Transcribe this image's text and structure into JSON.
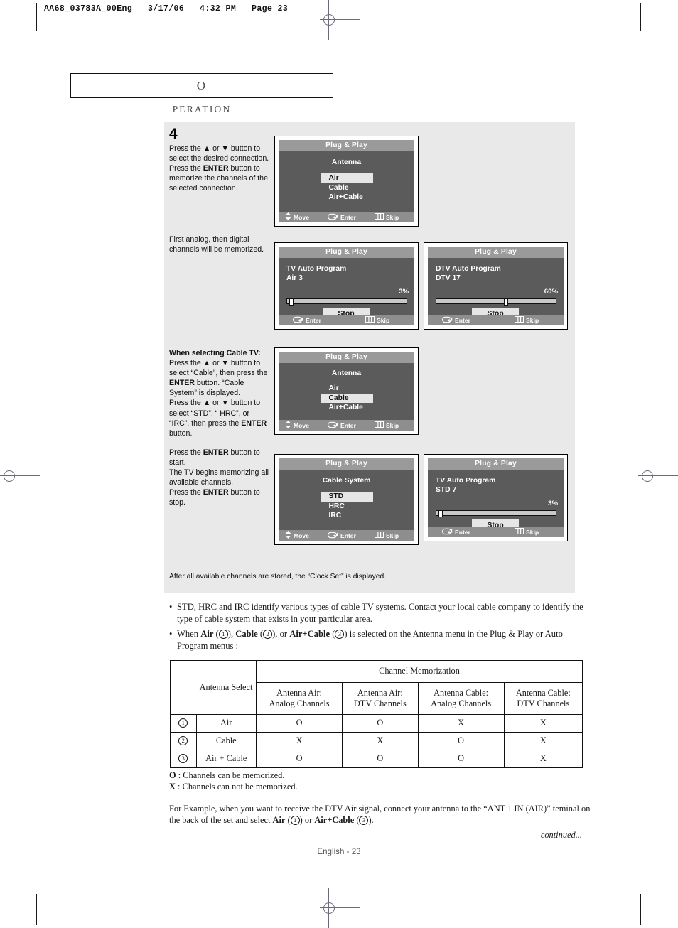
{
  "slug": "AA68_03783A_00Eng   3/17/06   4:32 PM   Page 23",
  "header": {
    "title_first": "O",
    "title_rest": "PERATION"
  },
  "steps": {
    "step_number": "4",
    "step4_text_1": "Press the ▲ or ▼ button to select the desired connection.",
    "step4_text_2_pre": "Press the ",
    "step4_text_2_bold": "ENTER",
    "step4_text_2_post": " button to memorize the channels of the selected connection.",
    "note_analog": "First analog, then digital channels will be memorized.",
    "cable_heading": "When selecting Cable TV:",
    "cable_p1a": "Press the ▲ or ▼ button to select “Cable”, then press the ",
    "cable_p1b": "ENTER",
    "cable_p1c": " button. “Cable System” is displayed.",
    "cable_p2a": "Press the ▲ or ▼ button to select “STD”, “ HRC”, or “IRC”, then press the ",
    "cable_p2b": "ENTER",
    "cable_p2c": " button.",
    "cable_p3a": "Press the ",
    "cable_p3b": "ENTER",
    "cable_p3c": " button to start.",
    "cable_p4": "The TV begins memorizing all available channels.",
    "cable_p5a": "Press the ",
    "cable_p5b": "ENTER",
    "cable_p5c": " button to stop."
  },
  "screens": {
    "antenna_air": {
      "title": "Plug & Play",
      "heading": "Antenna",
      "options": [
        "Air",
        "Cable",
        "Air+Cable"
      ],
      "selected_index": 0,
      "footer": [
        "Move",
        "Enter",
        "Skip"
      ]
    },
    "tv_auto_air": {
      "title": "Plug & Play",
      "line1": "TV Auto Program",
      "line2": "Air 3",
      "percent": "3%",
      "progress": 3,
      "button": "Stop",
      "footer": [
        "Enter",
        "Skip"
      ]
    },
    "dtv_auto": {
      "title": "Plug & Play",
      "line1": "DTV Auto Program",
      "line2": "DTV 17",
      "percent": "60%",
      "progress": 60,
      "button": "Stop",
      "footer": [
        "Enter",
        "Skip"
      ]
    },
    "antenna_cable": {
      "title": "Plug & Play",
      "heading": "Antenna",
      "options": [
        "Air",
        "Cable",
        "Air+Cable"
      ],
      "selected_index": 1,
      "footer": [
        "Move",
        "Enter",
        "Skip"
      ]
    },
    "cable_system": {
      "title": "Plug & Play",
      "heading": "Cable System",
      "options": [
        "STD",
        "HRC",
        "IRC"
      ],
      "selected_index": 0,
      "footer": [
        "Move",
        "Enter",
        "Skip"
      ]
    },
    "tv_auto_std": {
      "title": "Plug & Play",
      "line1": "TV Auto Program",
      "line2": "STD 7",
      "percent": "3%",
      "progress": 3,
      "button": "Stop",
      "footer": [
        "Enter",
        "Skip"
      ]
    }
  },
  "grey_note": "After all available channels are stored, the “Clock Set” is displayed.",
  "bullets": {
    "b1": "STD, HRC and IRC  identify various types of cable TV systems. Contact your local cable company to identify the type of cable system that exists in your particular area.",
    "b2_1": "When ",
    "b2_air": "Air",
    "b2_2": " (",
    "b2_n1": "1",
    "b2_3": "), ",
    "b2_cable": "Cable",
    "b2_4": " (",
    "b2_n2": "2",
    "b2_5": "), or ",
    "b2_aircable": "Air+Cable",
    "b2_6": " (",
    "b2_n3": "3",
    "b2_7": ") is selected on the Antenna menu in the Plug & Play or Auto Program menus :"
  },
  "table": {
    "col_antenna_select": "Antenna Select",
    "col_channel_memorization": "Channel Memorization",
    "subheads": [
      "Antenna Air:\nAnalog Channels",
      "Antenna Air:\nDTV Channels",
      "Antenna Cable:\nAnalog Channels",
      "Antenna Cable:\nDTV Channels"
    ],
    "rows": [
      {
        "num": "1",
        "label": "Air",
        "values": [
          "O",
          "O",
          "X",
          "X"
        ]
      },
      {
        "num": "2",
        "label": "Cable",
        "values": [
          "X",
          "X",
          "O",
          "X"
        ]
      },
      {
        "num": "3",
        "label": "Air + Cable",
        "values": [
          "O",
          "O",
          "O",
          "X"
        ]
      }
    ]
  },
  "legend": {
    "o_key": "O",
    "o_text": " : Channels can be memorized.",
    "x_key": "X",
    "x_text": " : Channels can not be memorized."
  },
  "example": {
    "p1": "For Example, when you want to receive the DTV Air signal, connect your antenna to the “ANT 1 IN (AIR)” teminal on the back of the set and select ",
    "air": "Air",
    "p2": " (",
    "n1": "1",
    "p3": ") or ",
    "aircable": "Air+Cable",
    "p4": " (",
    "n2": "3",
    "p5": ")."
  },
  "continued": "continued...",
  "footer": "English - 23",
  "colors": {
    "panel_grey": "#e9e9e9",
    "tv_body": "#5b5b5b",
    "tv_title_bar": "#9a9a9a",
    "tv_footer_bar": "#8e8e8e",
    "highlight": "#e6e6e6"
  }
}
